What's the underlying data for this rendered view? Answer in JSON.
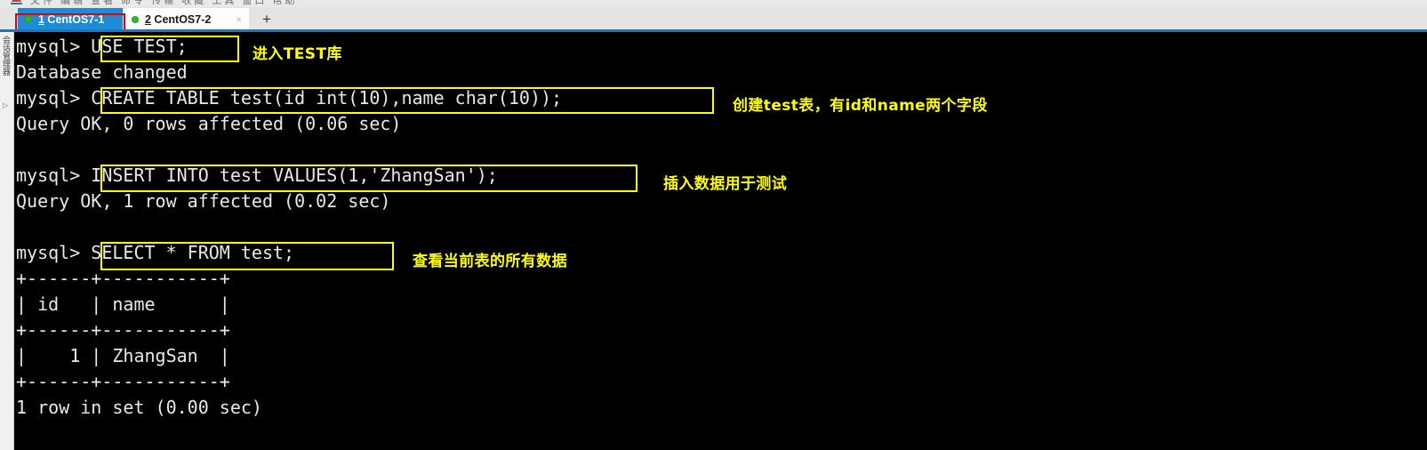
{
  "window": {
    "chrome_sliver_text": "文件 编辑 查看 命令 传输 收藏 工具 窗口 帮助",
    "logo_icon": "app-logo-icon"
  },
  "tabbar": {
    "tabs": [
      {
        "index": "1",
        "name": " CentOS7-1",
        "full_label": "1 CentOS7-1",
        "status_icon": "green-status-dot",
        "active": true,
        "highlighted": true,
        "highlight_color": "#e60000",
        "bg_color": "#1f8ad6",
        "text_color": "#ffffff",
        "overflow_icon": "chevron-left-icon"
      },
      {
        "index": "2",
        "name": " CentOS7-2",
        "full_label": "2 CentOS7-2",
        "status_icon": "green-status-dot",
        "active": false,
        "highlighted": false,
        "bg_color": "#fdfdfd",
        "text_color": "#1a1a1a",
        "close_icon": "×"
      }
    ],
    "new_tab_label": "+",
    "new_tab_icon": "plus-icon",
    "underline_color": "#1878c8"
  },
  "sidebar": {
    "vertical_label": "会话管理器",
    "collapse_icon": "▷"
  },
  "terminal": {
    "bg_color": "#000000",
    "fg_color": "#e8e8e8",
    "highlight_color": "#ffff00",
    "lines": [
      "mysql> USE TEST;",
      "Database changed",
      "mysql> CREATE TABLE test(id int(10),name char(10));",
      "Query OK, 0 rows affected (0.06 sec)",
      "",
      "mysql> INSERT INTO test VALUES(1,'ZhangSan');",
      "Query OK, 1 row affected (0.02 sec)",
      "",
      "mysql> SELECT * FROM test;",
      "+------+-----------+",
      "| id   | name      |",
      "+------+-----------+",
      "|    1 | ZhangSan  |",
      "+------+-----------+",
      "1 row in set (0.00 sec)"
    ],
    "annotations": [
      {
        "text": "进入TEST库",
        "command": "USE TEST;"
      },
      {
        "text": "创建test表，有id和name两个字段",
        "command": "CREATE TABLE test(id int(10),name char(10));"
      },
      {
        "text": "插入数据用于测试",
        "command": "INSERT INTO test VALUES(1,'ZhangSan');"
      },
      {
        "text": "查看当前表的所有数据",
        "command": "SELECT * FROM test;"
      }
    ]
  }
}
